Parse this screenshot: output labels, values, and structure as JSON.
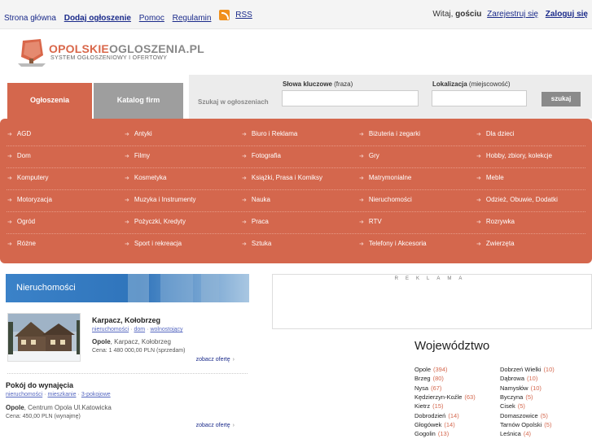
{
  "topbar": {
    "home": "Strona główna",
    "add": "Dodaj ogłoszenie",
    "help": "Pomoc",
    "rules": "Regulamin",
    "rss": "RSS",
    "greeting_prefix": "Witaj,",
    "greeting_user": "gościu",
    "register": "Zarejestruj się",
    "login": "Zaloguj się"
  },
  "logo": {
    "name_part1": "OPOLSKIE",
    "name_part2": "OGLOSZENIA.PL",
    "tagline": "SYSTEM OGŁOSZENIOWY I OFERTOWY"
  },
  "tabs": {
    "ads": "Ogłoszenia",
    "catalog": "Katalog firm"
  },
  "search": {
    "search_in": "Szukaj w ogłoszeniach",
    "keywords_label": "Słowa kluczowe",
    "keywords_hint": "(fraza)",
    "keywords_value": "",
    "location_label": "Lokalizacja",
    "location_hint": "(miejscowość)",
    "location_value": "",
    "button": "szukaj"
  },
  "categories": [
    [
      "AGD",
      "Antyki",
      "Biuro i Reklama",
      "Biżuteria i zegarki",
      "Dla dzieci"
    ],
    [
      "Dom",
      "Filmy",
      "Fotografia",
      "Gry",
      "Hobby, zbiory, kolekcje"
    ],
    [
      "Komputery",
      "Kosmetyka",
      "Książki, Prasa i Komiksy",
      "Matrymonialne",
      "Meble"
    ],
    [
      "Motoryzacja",
      "Muzyka i Instrumenty",
      "Nauka",
      "Nieruchomości",
      "Odzież, Obuwie, Dodatki"
    ],
    [
      "Ogród",
      "Pożyczki, Kredyty",
      "Praca",
      "RTV",
      "Rozrywka"
    ],
    [
      "Różne",
      "Sport i rekreacja",
      "Sztuka",
      "Telefony i Akcesoria",
      "Zwierzęta"
    ]
  ],
  "real_estate": {
    "title": "Nieruchomości",
    "listings": [
      {
        "title": "Karpacz, Kołobrzeg",
        "tags": [
          "nieruchomości",
          "dom",
          "wolnostojący"
        ],
        "place_bold": "Opole",
        "place_rest": ", Karpacz, Kołobrzeg",
        "price": "Cena: 1 480 000,00 PLN (sprzedam)",
        "more": "zobacz ofertę"
      },
      {
        "title": "Pokój do wynajęcia",
        "tags": [
          "nieruchomości",
          "mieszkanie",
          "3-pokojowe"
        ],
        "place_bold": "Opole",
        "place_rest": ", Centrum Opola Ul.Katowicka",
        "price": "Cena: 450,00 PLN (wynajmę)",
        "more": "zobacz ofertę"
      }
    ]
  },
  "ad": {
    "label": "REKLAMA"
  },
  "voivodeship": {
    "title": "Województwo",
    "col1": [
      {
        "name": "Opole",
        "count": "(394)"
      },
      {
        "name": "Brzeg",
        "count": "(80)"
      },
      {
        "name": "Nysa",
        "count": "(67)"
      },
      {
        "name": "Kędzierzyn-Koźle",
        "count": "(63)"
      },
      {
        "name": "Kietrz",
        "count": "(15)"
      },
      {
        "name": "Dobrodzień",
        "count": "(14)"
      },
      {
        "name": "Głogówek",
        "count": "(14)"
      },
      {
        "name": "Gogolin",
        "count": "(13)"
      }
    ],
    "col2": [
      {
        "name": "Dobrzeń Wielki",
        "count": "(10)"
      },
      {
        "name": "Dąbrowa",
        "count": "(10)"
      },
      {
        "name": "Namysłów",
        "count": "(10)"
      },
      {
        "name": "Byczyna",
        "count": "(5)"
      },
      {
        "name": "Cisek",
        "count": "(5)"
      },
      {
        "name": "Domaszowice",
        "count": "(5)"
      },
      {
        "name": "Tarnów Opolski",
        "count": "(5)"
      },
      {
        "name": "Leśnica",
        "count": "(4)"
      }
    ]
  },
  "colors": {
    "accent": "#d4674d",
    "tab_inactive": "#9e9e9e",
    "link": "#1a2a8a",
    "header_blue": "#1f6ab3"
  }
}
